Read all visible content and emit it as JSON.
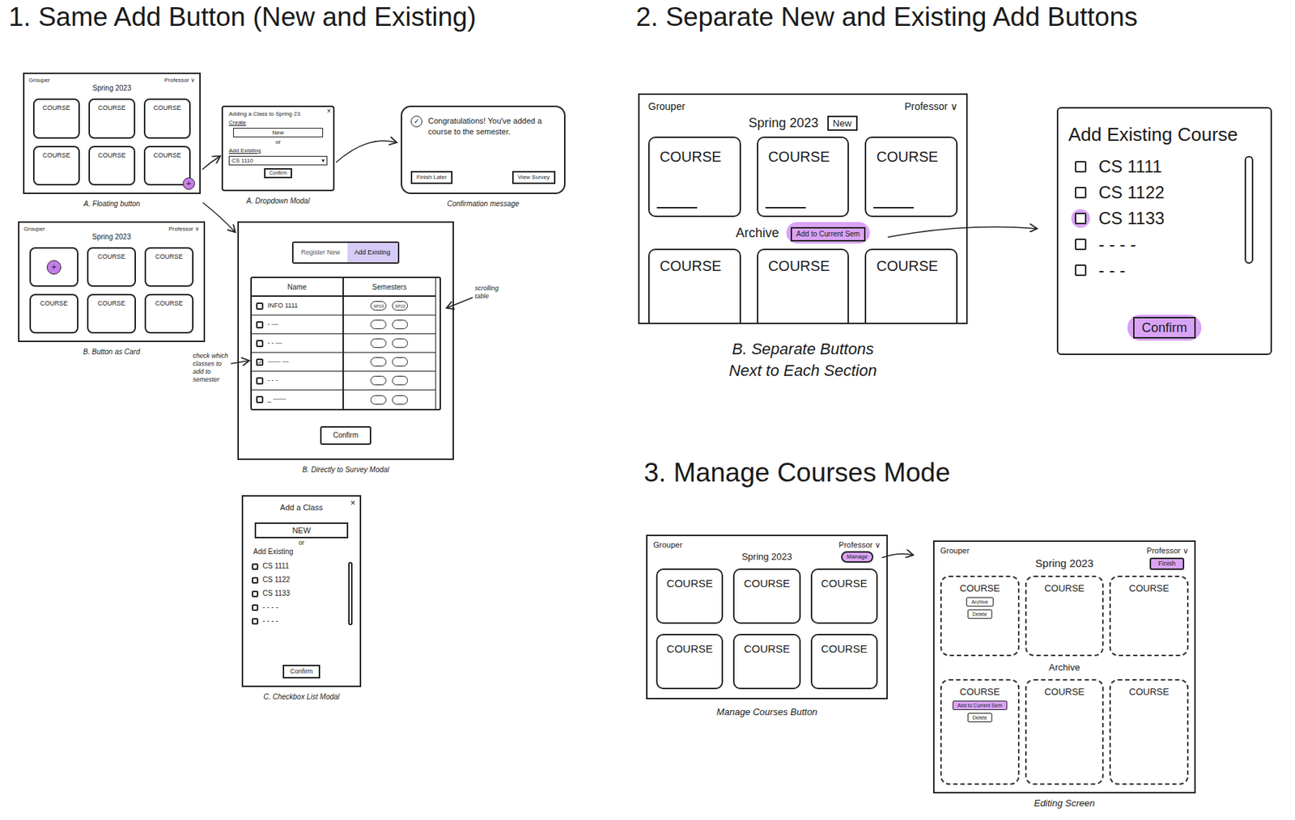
{
  "section1": {
    "title": "1. Same Add Button (New and Existing)",
    "floating_sketch": {
      "app": "Grouper",
      "user": "Professor ∨",
      "semester": "Spring 2023",
      "courses": [
        "COURSE",
        "COURSE",
        "COURSE",
        "COURSE",
        "COURSE",
        "COURSE"
      ],
      "add_button": "+",
      "caption": "A. Floating button"
    },
    "dropdown_modal": {
      "title": "Adding a Class to Spring 23",
      "close": "×",
      "create_label": "Create",
      "new_button": "New",
      "or": "or",
      "existing_label": "Add Existing",
      "select_value": "CS 1110",
      "select_arrow": "▾",
      "confirm": "Confirm",
      "caption": "A. Dropdown Modal"
    },
    "confirmation": {
      "icon": "✓",
      "message": "Congratulations! You've added a course to the semester.",
      "buttons": [
        "Finish Later",
        "View Survey"
      ],
      "caption": "Confirmation message"
    },
    "card_sketch": {
      "app": "Grouper",
      "user": "Professor ∨",
      "semester": "Spring 2023",
      "add_button": "+",
      "courses": [
        "COURSE",
        "COURSE",
        "COURSE",
        "COURSE",
        "COURSE"
      ],
      "caption": "B. Button as Card"
    },
    "survey_modal": {
      "tabs": [
        {
          "label": "Register New",
          "selected": false
        },
        {
          "label": "Add Existing",
          "selected": true
        }
      ],
      "columns": [
        "Name",
        "Semesters"
      ],
      "rows": [
        {
          "name": "INFO 1111",
          "checked": false,
          "semesters": [
            "SP23",
            "SP22"
          ]
        },
        {
          "name": "- —",
          "checked": false,
          "semesters": [
            "",
            ""
          ]
        },
        {
          "name": "- - —",
          "checked": false,
          "semesters": [
            "",
            ""
          ]
        },
        {
          "name": "—— —",
          "checked": true,
          "semesters": [
            "",
            ""
          ]
        },
        {
          "name": "- - -",
          "checked": false,
          "semesters": [
            "",
            ""
          ]
        },
        {
          "name": "_ ——",
          "checked": false,
          "semesters": [
            "",
            ""
          ]
        }
      ],
      "confirm": "Confirm",
      "scroll_note": "scrolling table",
      "check_note": "check which classes to add to semester",
      "caption": "B. Directly to Survey Modal"
    },
    "checkbox_modal": {
      "title": "Add a Class",
      "close": "×",
      "new_button": "NEW",
      "or": "or",
      "existing_label": "Add Existing",
      "items": [
        {
          "label": "CS 1111",
          "checked": false
        },
        {
          "label": "CS 1122",
          "checked": false
        },
        {
          "label": "CS 1133",
          "checked": false
        },
        {
          "label": "- - - -",
          "checked": false
        },
        {
          "label": "- - - -",
          "checked": false
        }
      ],
      "confirm": "Confirm",
      "caption": "C. Checkbox List Modal"
    }
  },
  "section2": {
    "title": "2. Separate New and Existing Add Buttons",
    "dashboard": {
      "app": "Grouper",
      "user": "Professor ∨",
      "semester": "Spring 2023",
      "new_button": {
        "label": "New",
        "highlighted": false
      },
      "courses": [
        "COURSE",
        "COURSE",
        "COURSE"
      ],
      "archive_label": "Archive",
      "archive_button": {
        "label": "Add to Current Sem",
        "highlighted": true
      },
      "archived_courses": [
        "COURSE",
        "COURSE",
        "COURSE"
      ]
    },
    "caption_lines": [
      "B. Separate Buttons",
      "Next to Each Section"
    ],
    "modal": {
      "title": "Add Existing Course",
      "items": [
        {
          "label": "CS 1111",
          "checked": false,
          "highlighted": false
        },
        {
          "label": "CS 1122",
          "checked": false,
          "highlighted": false
        },
        {
          "label": "CS 1133",
          "checked": false,
          "highlighted": true
        },
        {
          "label": "- - - -",
          "checked": false,
          "highlighted": false
        },
        {
          "label": "- - -",
          "checked": false,
          "highlighted": false
        }
      ],
      "confirm": {
        "label": "Confirm",
        "highlighted": true
      }
    }
  },
  "section3": {
    "title": "3. Manage Courses Mode",
    "dashboard": {
      "app": "Grouper",
      "user": "Professor ∨",
      "semester": "Spring 2023",
      "manage_button": {
        "label": "Manage",
        "highlighted": true
      },
      "courses": [
        "COURSE",
        "COURSE",
        "COURSE",
        "COURSE",
        "COURSE",
        "COURSE"
      ],
      "caption": "Manage Courses Button"
    },
    "editing": {
      "app": "Grouper",
      "user": "Professor ∨",
      "semester": "Spring 2023",
      "finish_button": {
        "label": "Finish",
        "highlighted": true
      },
      "courses": [
        {
          "label": "COURSE",
          "actions": [
            {
              "label": "Archive",
              "highlighted": false
            },
            {
              "label": "Delete",
              "highlighted": false
            }
          ]
        },
        {
          "label": "COURSE",
          "actions": []
        },
        {
          "label": "COURSE",
          "actions": []
        }
      ],
      "archive_label": "Archive",
      "archived_courses": [
        {
          "label": "COURSE",
          "actions": [
            {
              "label": "Add to Current Sem",
              "highlighted": true
            },
            {
              "label": "Delete",
              "highlighted": false
            }
          ]
        },
        {
          "label": "COURSE",
          "actions": []
        },
        {
          "label": "COURSE",
          "actions": []
        }
      ],
      "caption": "Editing Screen"
    }
  }
}
